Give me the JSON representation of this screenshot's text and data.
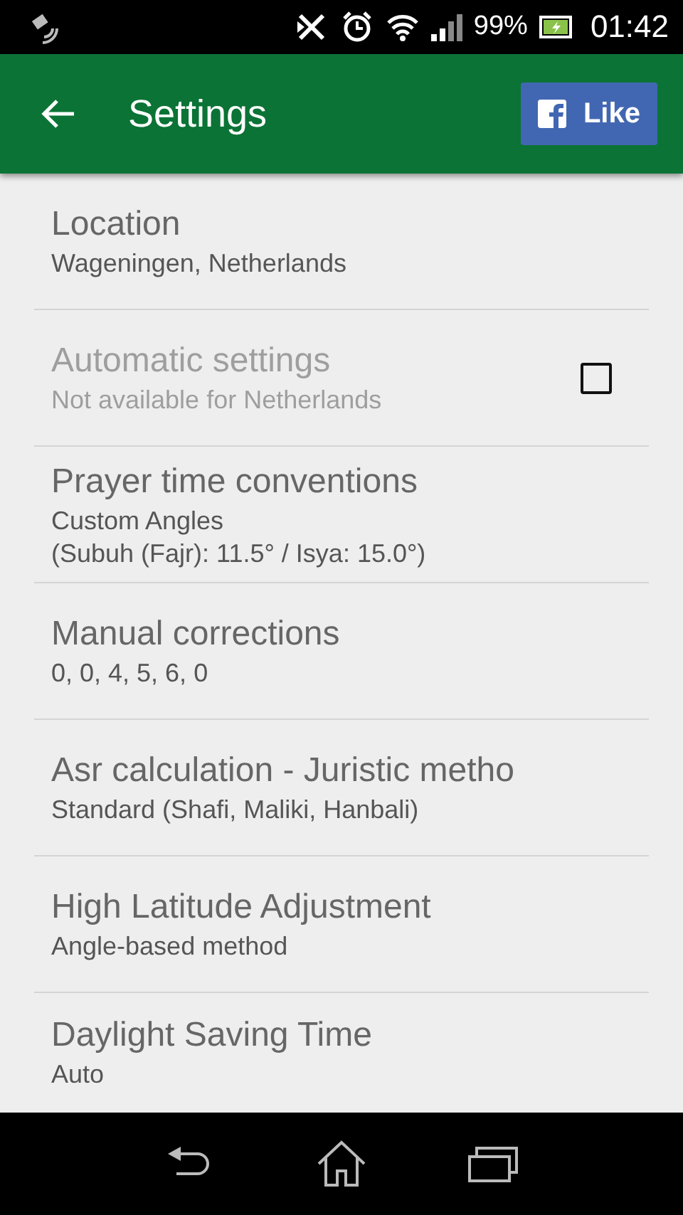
{
  "status_bar": {
    "battery": "99%",
    "time": "01:42"
  },
  "toolbar": {
    "title": "Settings",
    "like_button": "Like"
  },
  "settings": [
    {
      "kind": "text",
      "title": "Location",
      "summary": [
        "Wageningen, Netherlands"
      ],
      "disabled": false
    },
    {
      "kind": "checkbox",
      "title": "Automatic settings",
      "summary": [
        "Not available for Netherlands"
      ],
      "disabled": true,
      "checked": false
    },
    {
      "kind": "text",
      "title": "Prayer time conventions",
      "summary": [
        "Custom Angles",
        "(Subuh (Fajr): 11.5° / Isya: 15.0°)"
      ],
      "disabled": false
    },
    {
      "kind": "text",
      "title": "Manual corrections",
      "summary": [
        "0, 0, 4, 5, 6, 0"
      ],
      "disabled": false
    },
    {
      "kind": "text",
      "title": "Asr calculation - Juristic metho",
      "summary": [
        "Standard (Shafi, Maliki, Hanbali)"
      ],
      "disabled": false
    },
    {
      "kind": "text",
      "title": "High Latitude Adjustment",
      "summary": [
        "Angle-based method"
      ],
      "disabled": false
    },
    {
      "kind": "text",
      "title": "Daylight Saving Time",
      "summary": [
        "Auto"
      ],
      "disabled": false
    }
  ]
}
